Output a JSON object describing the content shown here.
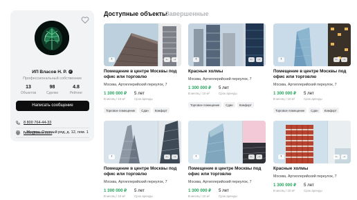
{
  "profile": {
    "name": "ИП Власов Н. Р.",
    "role": "Профессиональный собственник",
    "stats": [
      {
        "value": "13",
        "label": "Объектов"
      },
      {
        "value": "98",
        "label": "Сделки"
      },
      {
        "value": "4.8",
        "label": "Рейтинг"
      }
    ],
    "message_button": "Написать сообщение",
    "phone": "8 800 764-44-33",
    "address": "г. Москва, Охотный ряд, д. 12, пом. 1",
    "email": "hello@tome.com"
  },
  "tabs": [
    {
      "label": "Доступные объекты",
      "active": true
    },
    {
      "label": "Завершенные",
      "active": false
    }
  ],
  "listings": [
    {
      "title": "Помещение в центре Москвы под офис или торговлю",
      "address": "Москва, Артиллерийский переулок, 7",
      "price": "1 300 000 ₽",
      "price_label": "В месяц / 10 м²",
      "term": "5 лет",
      "term_label": "Срок аренды",
      "tags": [
        "Торговое помещение",
        "Сдан",
        "Комфорт"
      ]
    },
    {
      "title": "Красные холмы",
      "address": "Москва, Артиллерийский переулок, 7",
      "price": "1 300 000 ₽",
      "price_label": "В месяц / 10 м²",
      "term": "5 лет",
      "term_label": "Срок аренды",
      "tags": [
        "Торговое помещение",
        "Сдан",
        "Комфорт"
      ]
    },
    {
      "title": "Помещение в центре Москвы под офис или торговлю",
      "address": "Москва, Артиллерийский переулок, 7",
      "price": "1 300 000 ₽",
      "price_label": "В месяц / 10 м²",
      "term": "5 лет",
      "term_label": "Срок аренды",
      "tags": [
        "Торговое помещение",
        "Сдан",
        "Комфорт"
      ]
    },
    {
      "title": "Помещение в центре Москвы под офис или торговлю",
      "address": "Москва, Артиллерийский переулок, 7",
      "price": "1 300 000 ₽",
      "price_label": "В месяц / 10 м²",
      "term": "5 лет",
      "term_label": "Срок аренды",
      "tags": []
    },
    {
      "title": "Помещение в центре Москвы под офис или торговлю",
      "address": "Москва, Артиллерийский переулок, 7",
      "price": "1 300 000 ₽",
      "price_label": "В месяц / 10 м²",
      "term": "5 лет",
      "term_label": "Срок аренды",
      "tags": []
    },
    {
      "title": "Красные холмы",
      "address": "Москва, Артиллерийский переулок, 7",
      "price": "1 300 000 ₽",
      "price_label": "В месяц / 10 м²",
      "term": "5 лет",
      "term_label": "Срок аренды",
      "tags": []
    }
  ],
  "icons": {
    "like": "heart-outline-icon",
    "verified": "check-badge-icon",
    "phone": "phone-icon",
    "address": "location-pin-icon",
    "email": "mail-icon",
    "prev": "arrow-left-icon",
    "next": "arrow-right-icon"
  },
  "colors": {
    "price": "#22a35a",
    "button": "#0d0d0d",
    "panel": "#f2f3f5",
    "tab_inactive": "#b3b5b9"
  }
}
